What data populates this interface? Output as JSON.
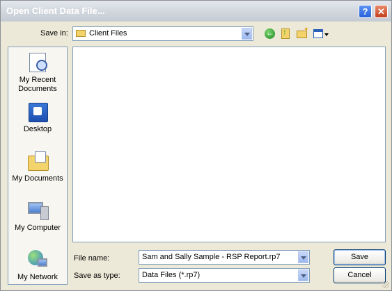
{
  "window": {
    "title": "Open Client Data File...",
    "help_label": "?",
    "close_label": "✕"
  },
  "toolbar": {
    "save_in_label": "Save in:",
    "save_in_value": "Client Files",
    "icons": [
      "back-icon",
      "up-folder-icon",
      "new-folder-icon",
      "views-menu-icon"
    ]
  },
  "places": [
    {
      "label": "My Recent Documents",
      "icon": "recent-documents-icon"
    },
    {
      "label": "Desktop",
      "icon": "desktop-icon"
    },
    {
      "label": "My Documents",
      "icon": "my-documents-icon"
    },
    {
      "label": "My Computer",
      "icon": "my-computer-icon"
    },
    {
      "label": "My Network",
      "icon": "my-network-icon"
    }
  ],
  "form": {
    "file_name_label": "File name:",
    "file_name_value": "Sam and Sally Sample - RSP Report.rp7",
    "save_as_type_label": "Save as type:",
    "save_as_type_value": "Data Files (*.rp7)"
  },
  "buttons": {
    "save": "Save",
    "cancel": "Cancel"
  }
}
